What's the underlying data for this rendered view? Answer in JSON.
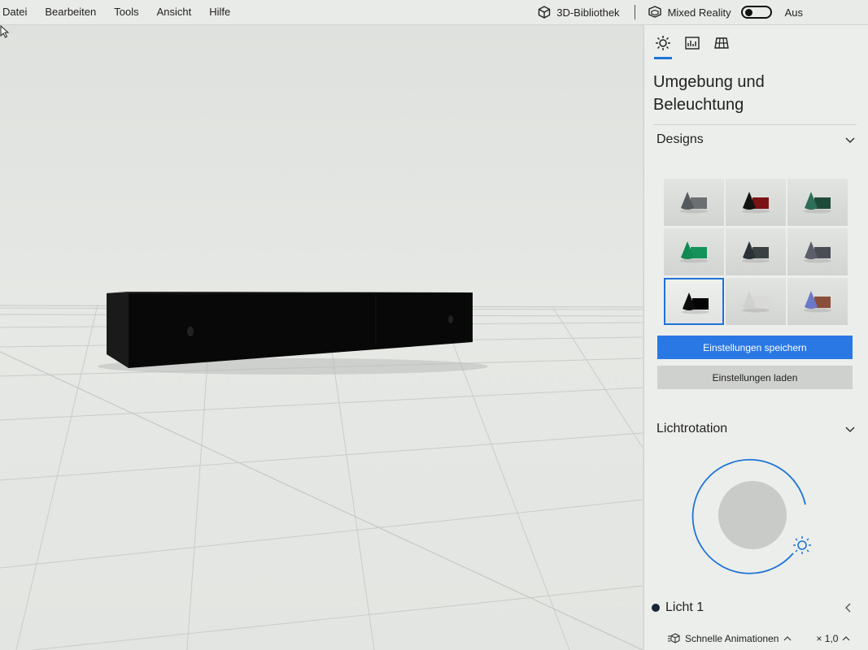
{
  "menu": {
    "items": [
      "Datei",
      "Bearbeiten",
      "Tools",
      "Ansicht",
      "Hilfe"
    ],
    "library_label": "3D-Bibliothek",
    "mixed_reality_label": "Mixed Reality",
    "mixed_reality_state": "Aus"
  },
  "panel": {
    "title": "Umgebung und Beleuchtung",
    "designs_header": "Designs",
    "designs": [
      {
        "icon": "theme-gray-icon",
        "cone": "#555a5e",
        "box": "#6b6f72",
        "selected": false
      },
      {
        "icon": "theme-red-icon",
        "cone": "#131313",
        "box": "#7a1414",
        "selected": false
      },
      {
        "icon": "theme-dark-green-icon",
        "cone": "#2f6e58",
        "box": "#1f4a3a",
        "selected": false
      },
      {
        "icon": "theme-green-icon",
        "cone": "#118a52",
        "box": "#13935a",
        "selected": false
      },
      {
        "icon": "theme-charcoal-icon",
        "cone": "#2a3235",
        "box": "#394143",
        "selected": false
      },
      {
        "icon": "theme-slate-icon",
        "cone": "#5c5f6a",
        "box": "#4b4d54",
        "selected": false
      },
      {
        "icon": "theme-black-icon",
        "cone": "#0d0d0d",
        "box": "#050505",
        "selected": true
      },
      {
        "icon": "theme-white-icon",
        "cone": "#cfd1cf",
        "box": "#d9dad8",
        "selected": false
      },
      {
        "icon": "theme-multicolor-icon",
        "cone": "#6a78c8",
        "box": "#8b4e3a",
        "selected": false
      }
    ],
    "save_button": "Einstellungen speichern",
    "load_button": "Einstellungen laden",
    "light_rotation_header": "Lichtrotation",
    "light_label": "Licht 1",
    "quick_animations_label": "Schnelle Animationen",
    "zoom_label": "× 1,0"
  },
  "colors": {
    "accent": "#1e73d8",
    "primary_button": "#2a78e4",
    "object": "#0a0a0a"
  }
}
